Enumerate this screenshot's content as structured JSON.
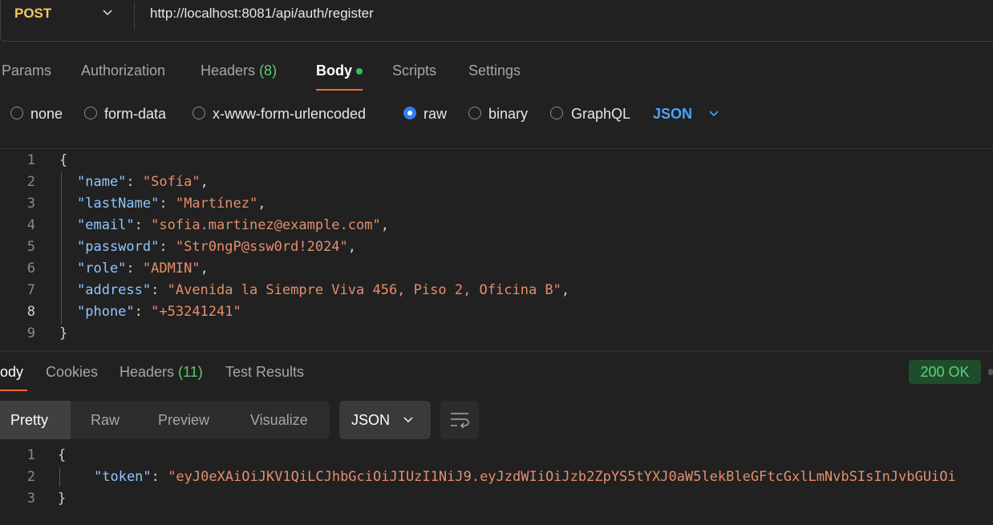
{
  "request": {
    "method": "POST",
    "url": "http://localhost:8081/api/auth/register"
  },
  "request_tabs": {
    "params": "Params",
    "authorization": "Authorization",
    "headers": "Headers",
    "headers_count": "(8)",
    "body": "Body",
    "scripts": "Scripts",
    "settings": "Settings"
  },
  "body_types": {
    "none": "none",
    "form_data": "form-data",
    "urlencoded": "x-www-form-urlencoded",
    "raw": "raw",
    "binary": "binary",
    "graphql": "GraphQL",
    "selected": "raw",
    "language": "JSON"
  },
  "request_body": {
    "line_numbers": [
      "1",
      "2",
      "3",
      "4",
      "5",
      "6",
      "7",
      "8",
      "9"
    ],
    "open_brace": "{",
    "close_brace": "}",
    "fields": [
      {
        "key": "\"name\"",
        "value": "\"Sofía\"",
        "comma": ","
      },
      {
        "key": "\"lastName\"",
        "value": "\"Martínez\"",
        "comma": ","
      },
      {
        "key": "\"email\"",
        "value": "\"sofia.martinez@example.com\"",
        "comma": ","
      },
      {
        "key": "\"password\"",
        "value": "\"Str0ngP@ssw0rd!2024\"",
        "comma": ","
      },
      {
        "key": "\"role\"",
        "value": "\"ADMIN\"",
        "comma": ","
      },
      {
        "key": "\"address\"",
        "value": "\"Avenida la Siempre Viva 456, Piso 2, Oficina B\"",
        "comma": ","
      },
      {
        "key": "\"phone\"",
        "value": "\"+53241241\"",
        "comma": ""
      }
    ]
  },
  "response_tabs": {
    "body": "ody",
    "cookies": "Cookies",
    "headers": "Headers",
    "headers_count": "(11)",
    "test_results": "Test Results"
  },
  "status": "200 OK",
  "view_modes": {
    "pretty": "Pretty",
    "raw": "Raw",
    "preview": "Preview",
    "visualize": "Visualize",
    "format": "JSON"
  },
  "response_body": {
    "line_numbers": [
      "1",
      "2",
      "3"
    ],
    "open_brace": "{",
    "close_brace": "}",
    "token_key": "\"token\"",
    "token_value": "\"eyJ0eXAiOiJKV1QiLCJhbGciOiJIUzI1NiJ9.eyJzdWIiOiJzb2ZpYS5tYXJ0aW5lekBleGFtcGxlLmNvbSIsInJvbGUiOi"
  },
  "colors": {
    "background": "#212121",
    "method": "#f6c85f",
    "accent_orange": "#f26b3a",
    "json_key": "#8fc6ff",
    "json_string": "#e58e6c",
    "status_ok": "#5fd07a",
    "link_blue": "#4aa3ff"
  },
  "icons": [
    "chevron-down-icon",
    "wrap-lines-icon",
    "radio-icon"
  ]
}
